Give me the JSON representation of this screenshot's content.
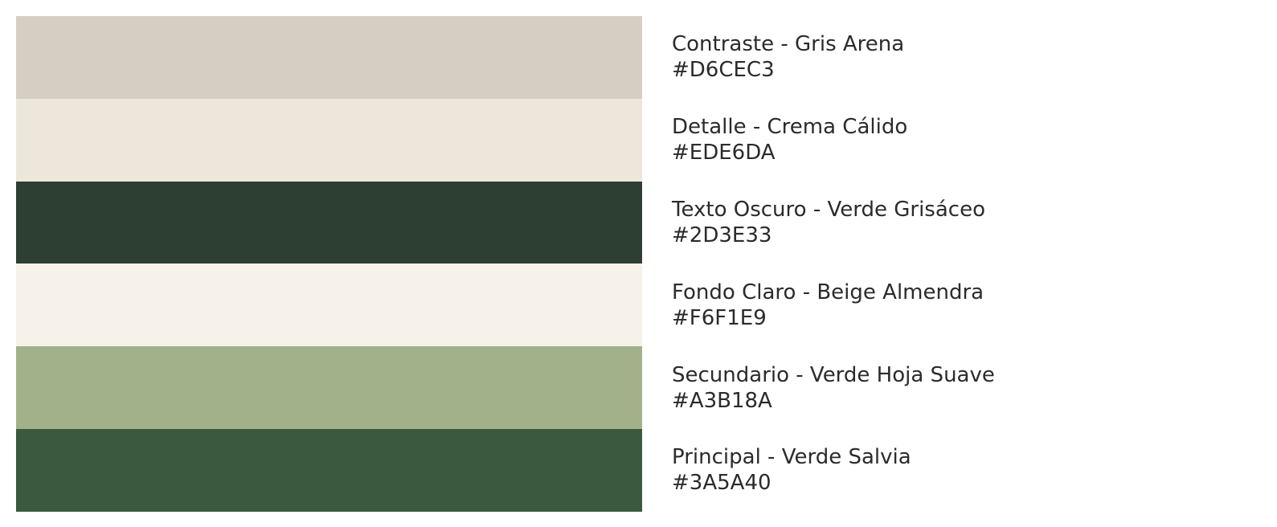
{
  "palette": {
    "colors": [
      {
        "name": "Contraste - Gris Arena",
        "hex": "#D6CEC3"
      },
      {
        "name": "Detalle - Crema Cálido",
        "hex": "#EDE6DA"
      },
      {
        "name": "Texto Oscuro - Verde Grisáceo",
        "hex": "#2D3E33"
      },
      {
        "name": "Fondo Claro - Beige Almendra",
        "hex": "#F6F1E9"
      },
      {
        "name": "Secundario - Verde Hoja Suave",
        "hex": "#A3B18A"
      },
      {
        "name": "Principal - Verde Salvia",
        "hex": "#3A5A40"
      }
    ]
  }
}
